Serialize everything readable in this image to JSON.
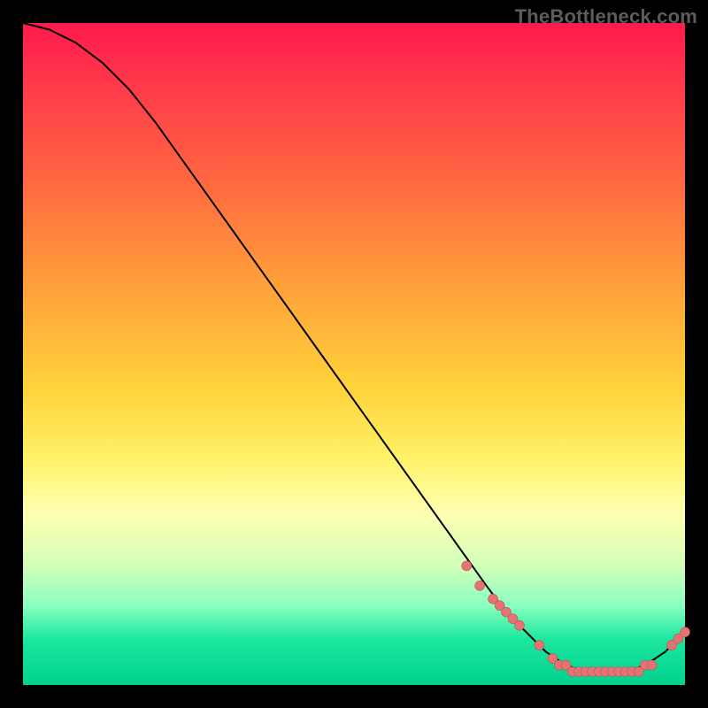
{
  "watermark": "TheBottleneck.com",
  "chart_data": {
    "type": "line",
    "title": "",
    "xlabel": "",
    "ylabel": "",
    "xlim": [
      0,
      100
    ],
    "ylim": [
      0,
      100
    ],
    "series": [
      {
        "name": "curve",
        "x": [
          0,
          4,
          8,
          12,
          16,
          20,
          25,
          30,
          35,
          40,
          45,
          50,
          55,
          60,
          65,
          70,
          73,
          76,
          79,
          82,
          85,
          88,
          91,
          94,
          97,
          100
        ],
        "y": [
          100,
          99,
          97,
          94,
          90,
          85,
          78,
          71,
          64,
          57,
          50,
          43,
          36,
          29,
          22,
          15,
          11,
          8,
          5,
          3,
          2,
          2,
          2,
          3,
          5,
          8
        ]
      }
    ],
    "points": {
      "name": "highlight",
      "x": [
        67,
        69,
        71,
        72,
        73,
        74,
        75,
        78,
        80,
        81,
        82,
        83,
        84,
        85,
        86,
        87,
        88,
        89,
        90,
        91,
        92,
        93,
        94,
        95,
        98,
        99,
        100
      ],
      "y": [
        18,
        15,
        13,
        12,
        11,
        10,
        9,
        6,
        4,
        3,
        3,
        2,
        2,
        2,
        2,
        2,
        2,
        2,
        2,
        2,
        2,
        2,
        3,
        3,
        6,
        7,
        8
      ]
    },
    "colors": {
      "gradient_top": "#ff1a4d",
      "gradient_bottom": "#00d28e",
      "curve": "#000000",
      "point_fill": "#e57373"
    }
  }
}
